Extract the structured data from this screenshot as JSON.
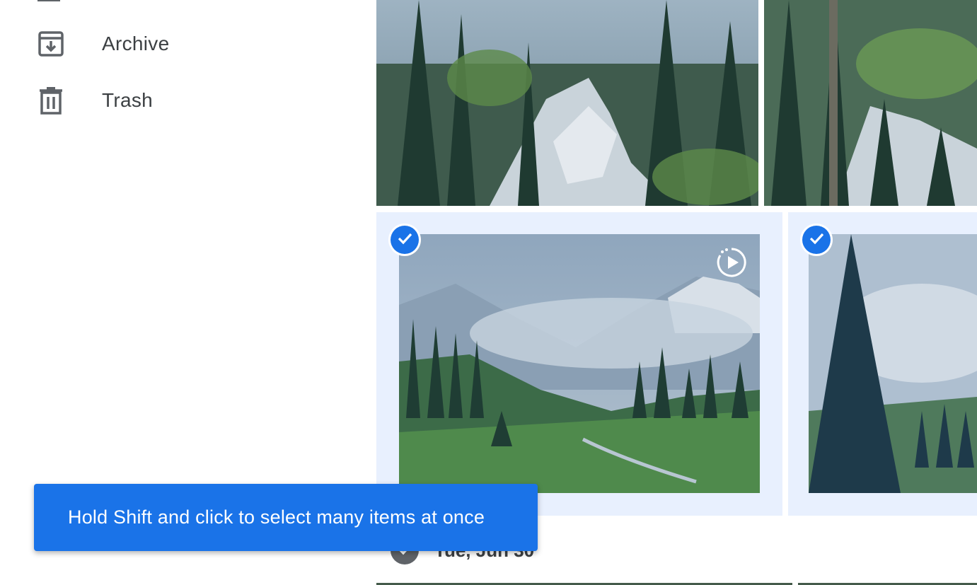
{
  "sidebar": {
    "items": [
      {
        "label": "Archive",
        "icon": "archive-icon"
      },
      {
        "label": "Trash",
        "icon": "trash-icon"
      }
    ]
  },
  "photos": {
    "selected_count_visible": 2,
    "motion_badge_icon": "motion-photo-icon"
  },
  "date_group": {
    "label": "Tue, Jun 30"
  },
  "toast": {
    "message": "Hold Shift and click to select many items at once"
  },
  "colors": {
    "accent": "#1a73e8",
    "selection_bg": "#e8f0fe",
    "text": "#3c4043",
    "icon": "#5f6368"
  }
}
